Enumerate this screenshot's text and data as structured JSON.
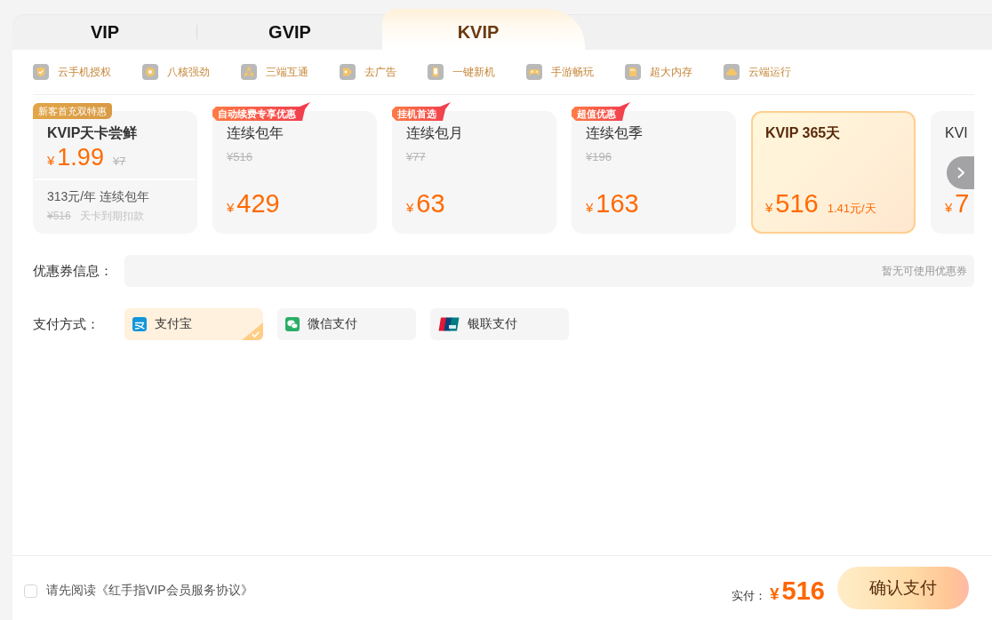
{
  "tabs": [
    {
      "label": "VIP",
      "selected": false
    },
    {
      "label": "GVIP",
      "selected": false
    },
    {
      "label": "KVIP",
      "selected": true
    }
  ],
  "features": [
    "云手机授权",
    "八核强劲",
    "三端互通",
    "去广告",
    "一键新机",
    "手游畅玩",
    "超大内存",
    "云端运行"
  ],
  "plans": [
    {
      "kind": "trial",
      "badge": {
        "kind": "gold",
        "text": "新客首充双特惠"
      },
      "title": "KVIP天卡尝鲜",
      "currency": "¥",
      "price": "1.99",
      "original_price": "¥7",
      "renewal": "313元/年 连续包年",
      "renewal_original_price": "¥516",
      "renewal_note": "天卡到期扣款",
      "selected": false
    },
    {
      "kind": "standard",
      "badge": {
        "kind": "flag",
        "text": "自动续费专享优惠"
      },
      "title": "连续包年",
      "original_price": "¥516",
      "currency": "¥",
      "price": "429",
      "selected": false
    },
    {
      "kind": "standard",
      "badge": {
        "kind": "flag",
        "text": "挂机首选"
      },
      "title": "连续包月",
      "original_price": "¥77",
      "currency": "¥",
      "price": "63",
      "selected": false
    },
    {
      "kind": "standard",
      "badge": {
        "kind": "flag",
        "text": "超值优惠"
      },
      "title": "连续包季",
      "original_price": "¥196",
      "currency": "¥",
      "price": "163",
      "selected": false
    },
    {
      "kind": "standard",
      "title": "KVIP 365天",
      "currency": "¥",
      "price": "516",
      "daily_price": "1.41元/天",
      "selected": true
    },
    {
      "kind": "standard",
      "title": "KVI",
      "currency": "¥",
      "price": "7",
      "selected": false
    }
  ],
  "coupon": {
    "label": "优惠券信息：",
    "value": "暂无可使用优惠券"
  },
  "payment": {
    "label": "支付方式：",
    "methods": [
      {
        "kind": "alipay",
        "label": "支付宝",
        "selected": true
      },
      {
        "kind": "wechat",
        "label": "微信支付",
        "selected": false
      },
      {
        "kind": "unionpay",
        "label": "银联支付",
        "selected": false
      }
    ]
  },
  "footer": {
    "agreement": {
      "text": "请先阅读《红手指VIP会员服务协议》",
      "checked": false
    },
    "total_label": "实付：",
    "total_currency": "¥",
    "total": "516",
    "confirm_button": "确认支付"
  }
}
